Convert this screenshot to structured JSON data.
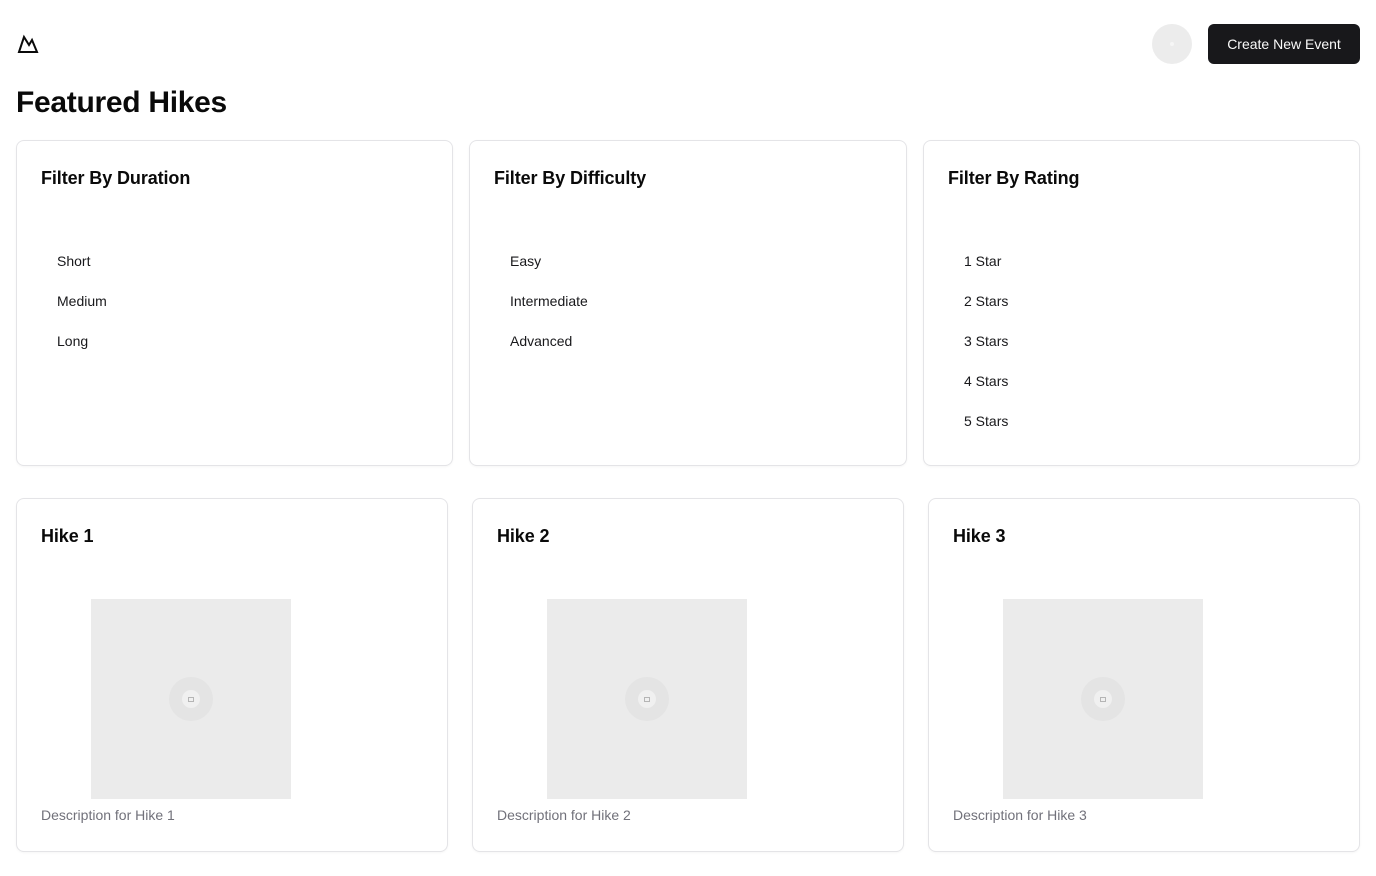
{
  "header": {
    "logo_icon": "mountain-icon",
    "avatar_icon": "user-avatar",
    "create_button_label": "Create New Event"
  },
  "page": {
    "title": "Featured Hikes"
  },
  "filters": {
    "duration": {
      "title": "Filter By Duration",
      "options": [
        "Short",
        "Medium",
        "Long"
      ]
    },
    "difficulty": {
      "title": "Filter By Difficulty",
      "options": [
        "Easy",
        "Intermediate",
        "Advanced"
      ]
    },
    "rating": {
      "title": "Filter By Rating",
      "options": [
        "1 Star",
        "2 Stars",
        "3 Stars",
        "4 Stars",
        "5 Stars"
      ]
    }
  },
  "hikes": [
    {
      "title": "Hike 1",
      "description": "Description for Hike 1",
      "image_icon": "image-placeholder-icon"
    },
    {
      "title": "Hike 2",
      "description": "Description for Hike 2",
      "image_icon": "image-placeholder-icon"
    },
    {
      "title": "Hike 3",
      "description": "Description for Hike 3",
      "image_icon": "image-placeholder-icon"
    }
  ],
  "colors": {
    "primary_button": "#18181b",
    "border": "#e4e4e7",
    "muted_text": "#71717a",
    "placeholder_bg": "#ebebeb"
  }
}
